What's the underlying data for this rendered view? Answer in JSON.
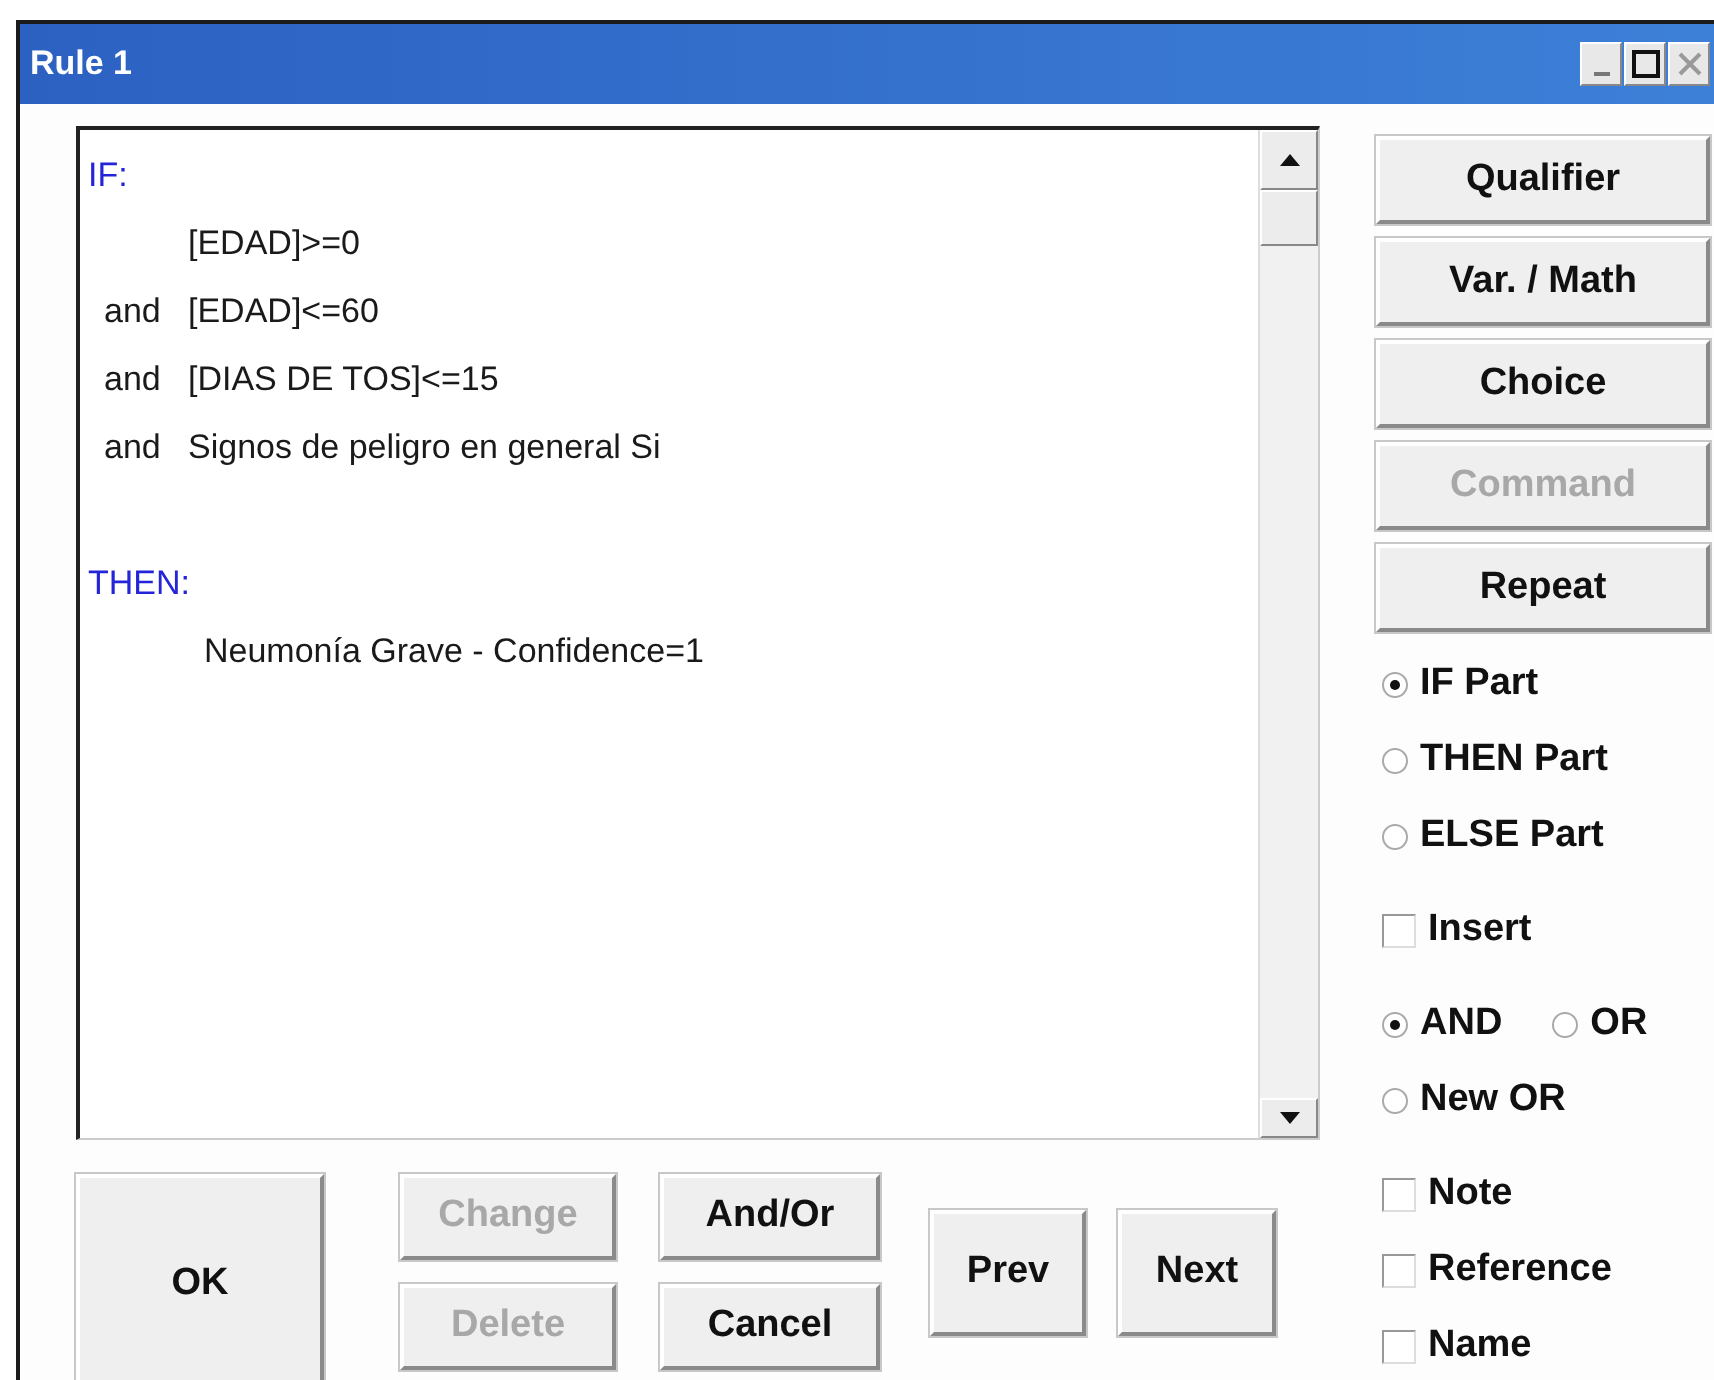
{
  "window": {
    "title": "Rule 1"
  },
  "rule_text": {
    "lines": [
      {
        "kind": "header",
        "text": "IF:"
      },
      {
        "kind": "condition",
        "text": "[EDAD]>=0"
      },
      {
        "kind": "condition",
        "connector": "and",
        "text": "[EDAD]<=60"
      },
      {
        "kind": "condition",
        "connector": "and",
        "text": "[DIAS DE TOS]<=15"
      },
      {
        "kind": "condition",
        "connector": "and",
        "text": "Signos de peligro en general Si"
      },
      {
        "kind": "blank"
      },
      {
        "kind": "header",
        "text": "THEN:"
      },
      {
        "kind": "action",
        "text": "Neumonía Grave - Confidence=1"
      }
    ]
  },
  "side_buttons": [
    {
      "label": "Qualifier",
      "disabled": false
    },
    {
      "label": "Var. / Math",
      "disabled": false
    },
    {
      "label": "Choice",
      "disabled": false
    },
    {
      "label": "Command",
      "disabled": true
    },
    {
      "label": "Repeat",
      "disabled": false
    }
  ],
  "part_options": [
    {
      "label": "IF Part",
      "selected": true
    },
    {
      "label": "THEN Part",
      "selected": false
    },
    {
      "label": "ELSE Part",
      "selected": false
    }
  ],
  "insert": {
    "label": "Insert",
    "checked": false
  },
  "connector_options": [
    {
      "label": "AND",
      "selected": true
    },
    {
      "label": "OR",
      "selected": false
    },
    {
      "label": "New OR",
      "selected": false
    }
  ],
  "extras": [
    {
      "label": "Note",
      "checked": false
    },
    {
      "label": "Reference",
      "checked": false
    },
    {
      "label": "Name",
      "checked": false
    }
  ],
  "bottom_buttons": {
    "ok": {
      "label": "OK",
      "disabled": false
    },
    "change": {
      "label": "Change",
      "disabled": true
    },
    "delete": {
      "label": "Delete",
      "disabled": true
    },
    "and_or": {
      "label": "And/Or",
      "disabled": false
    },
    "cancel": {
      "label": "Cancel",
      "disabled": false
    },
    "prev": {
      "label": "Prev",
      "disabled": false
    },
    "next": {
      "label": "Next",
      "disabled": false
    }
  }
}
